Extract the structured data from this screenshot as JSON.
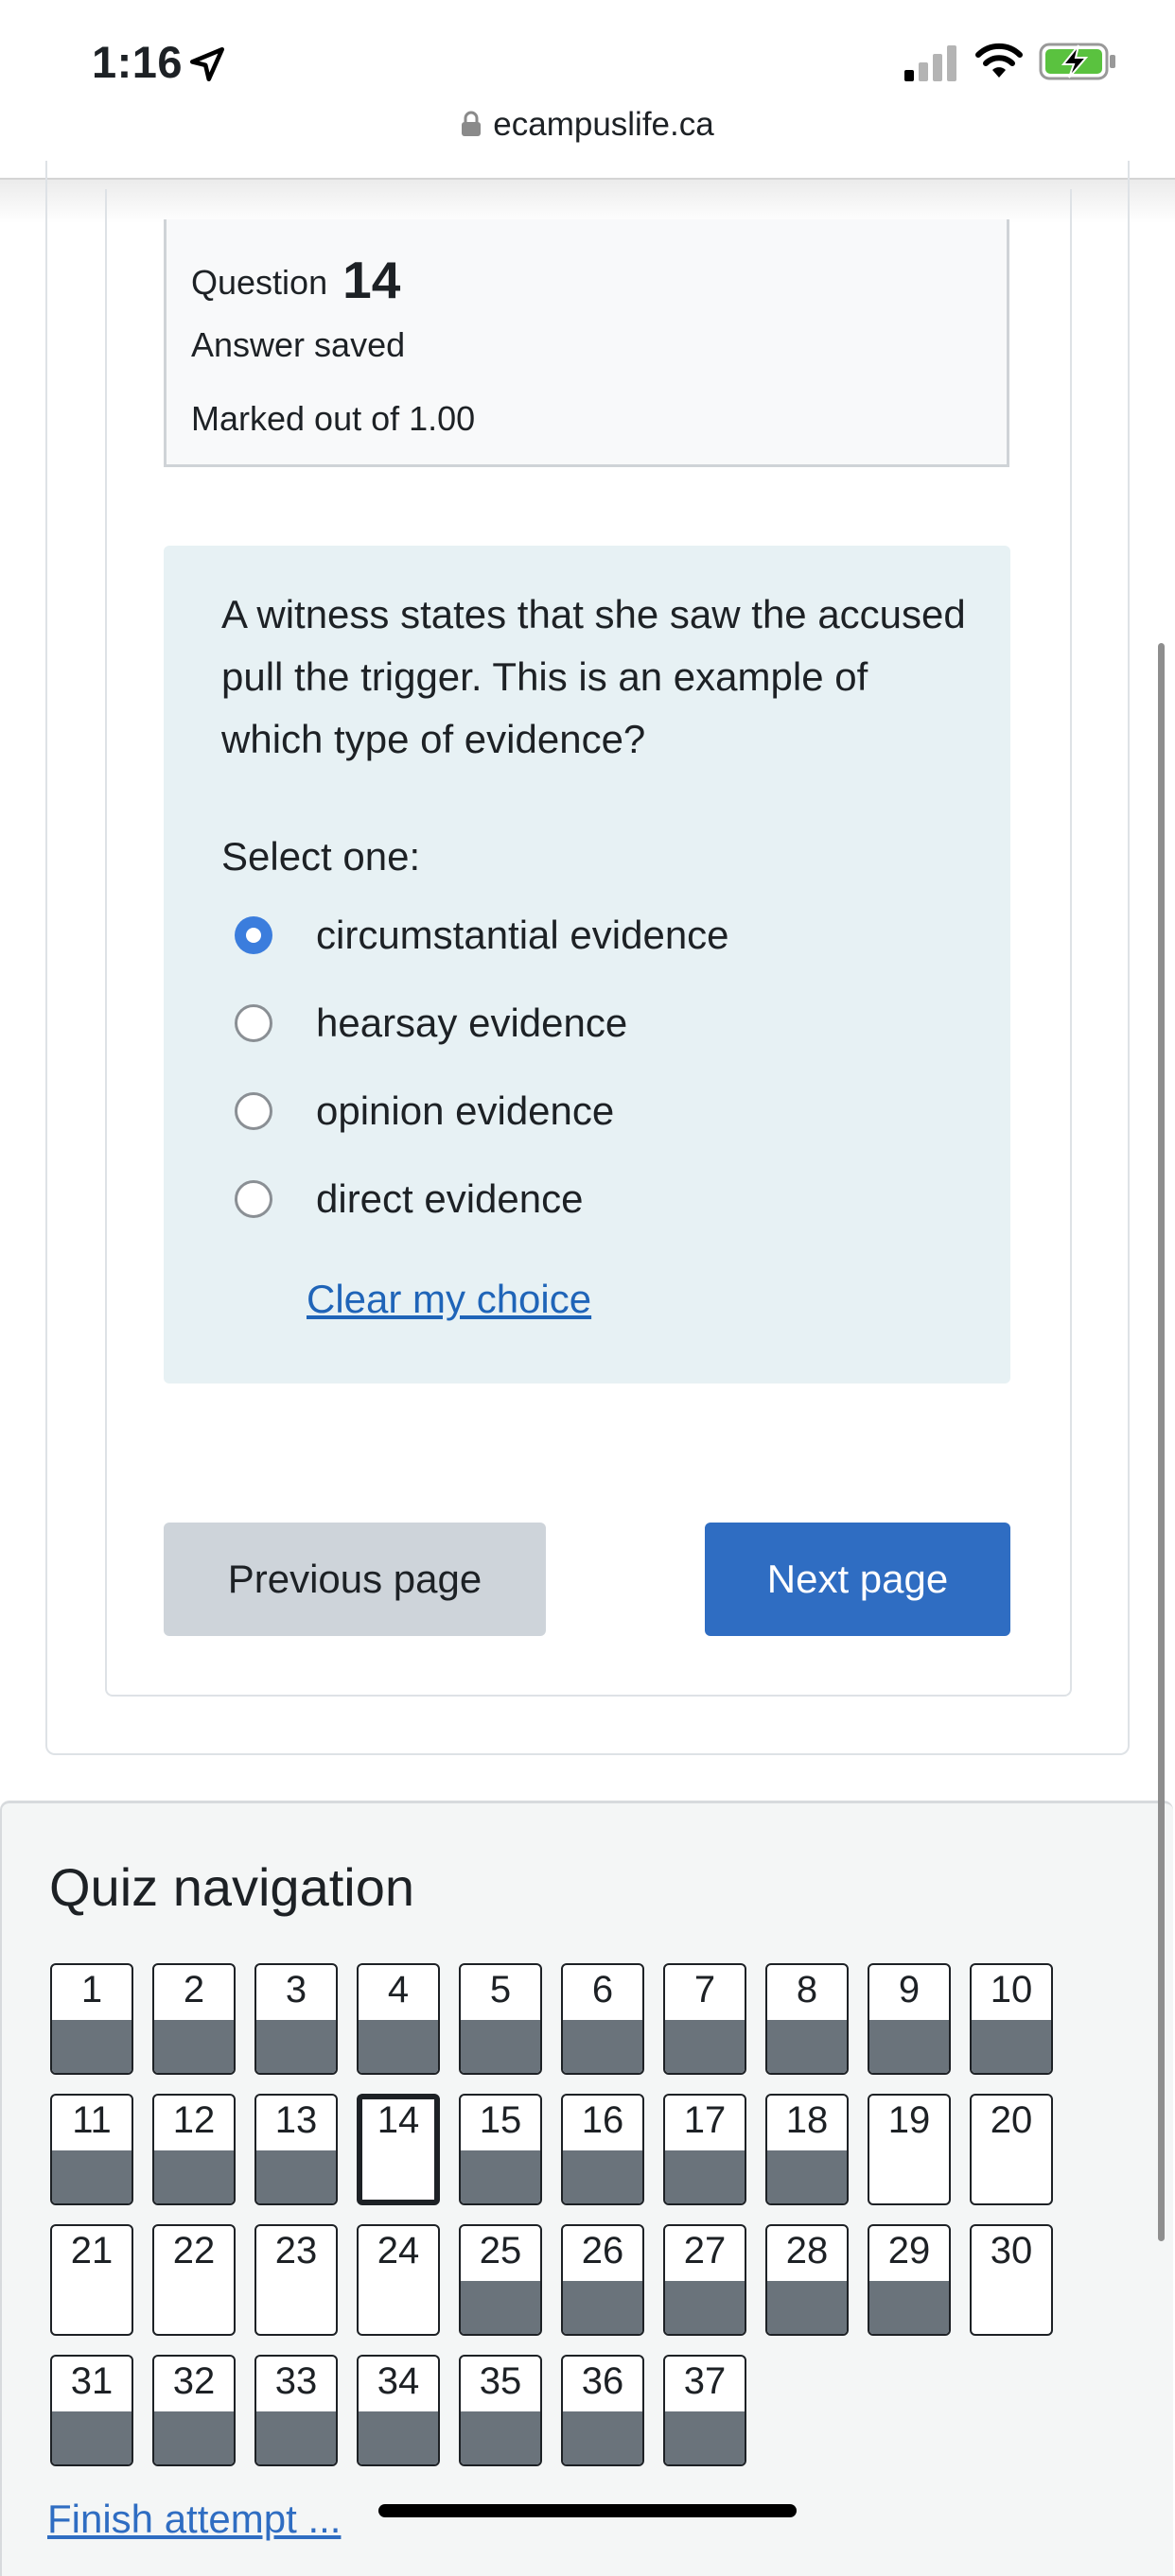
{
  "status_bar": {
    "time": "1:16",
    "url": "ecampuslife.ca"
  },
  "question": {
    "label": "Question",
    "number": "14",
    "status": "Answer saved",
    "mark": "Marked out of 1.00",
    "text": "A witness states that she saw the accused pull the trigger. This is an example of which type of evidence?",
    "prompt": "Select one:",
    "answers": [
      {
        "label": "circumstantial evidence",
        "selected": true
      },
      {
        "label": "hearsay evidence",
        "selected": false
      },
      {
        "label": "opinion evidence",
        "selected": false
      },
      {
        "label": "direct evidence",
        "selected": false
      }
    ],
    "clear_label": "Clear my choice"
  },
  "buttons": {
    "previous": "Previous page",
    "next": "Next page"
  },
  "quiz_nav": {
    "title": "Quiz navigation",
    "current": 14,
    "answered": [
      1,
      2,
      3,
      4,
      5,
      6,
      7,
      8,
      9,
      10,
      11,
      12,
      13,
      15,
      16,
      17,
      18,
      25,
      26,
      27,
      28,
      29,
      31,
      32,
      33,
      34,
      35,
      36,
      37
    ],
    "questions": [
      "1",
      "2",
      "3",
      "4",
      "5",
      "6",
      "7",
      "8",
      "9",
      "10",
      "11",
      "12",
      "13",
      "14",
      "15",
      "16",
      "17",
      "18",
      "19",
      "20",
      "21",
      "22",
      "23",
      "24",
      "25",
      "26",
      "27",
      "28",
      "29",
      "30",
      "31",
      "32",
      "33",
      "34",
      "35",
      "36",
      "37"
    ],
    "finish_label": "Finish attempt ..."
  },
  "colors": {
    "accent": "#2f6dc2",
    "radio_selected": "#3b7ddd",
    "answered_fill": "#6a737b"
  }
}
